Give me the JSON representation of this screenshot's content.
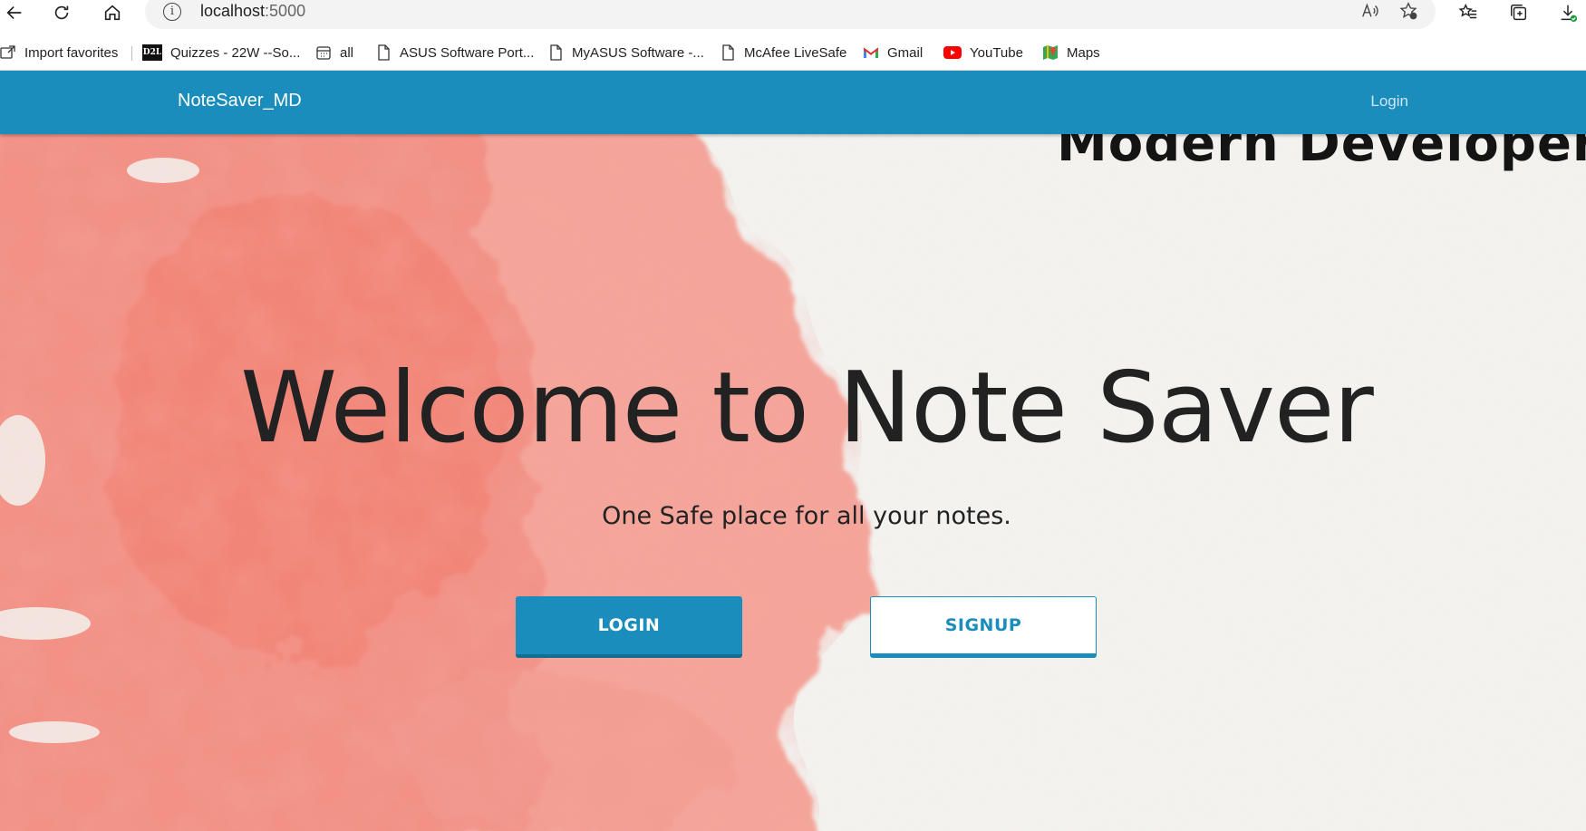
{
  "browser": {
    "url_host": "localhost",
    "url_port": ":5000",
    "bookmarks": [
      {
        "label": "Import favorites",
        "icon": "import-icon"
      },
      {
        "label": "Quizzes - 22W --So...",
        "icon": "d2l-icon"
      },
      {
        "label": "all",
        "icon": "calendar-icon"
      },
      {
        "label": "ASUS Software Port...",
        "icon": "page-icon"
      },
      {
        "label": "MyASUS Software -...",
        "icon": "page-icon"
      },
      {
        "label": "McAfee LiveSafe",
        "icon": "page-icon"
      },
      {
        "label": "Gmail",
        "icon": "gmail-icon"
      },
      {
        "label": "YouTube",
        "icon": "youtube-icon"
      },
      {
        "label": "Maps",
        "icon": "maps-icon"
      }
    ],
    "d2l_badge": "D2L"
  },
  "navbar": {
    "brand": "NoteSaver_MD",
    "login_link": "Login"
  },
  "hero": {
    "banner_text": "Modern Developers",
    "title": "Welcome to Note Saver",
    "subtitle": "One Safe place for all your notes.",
    "login_button": "LOGIN",
    "signup_button": "SIGNUP"
  },
  "colors": {
    "primary": "#1a8dbd",
    "watercolor": "#f4857a"
  }
}
